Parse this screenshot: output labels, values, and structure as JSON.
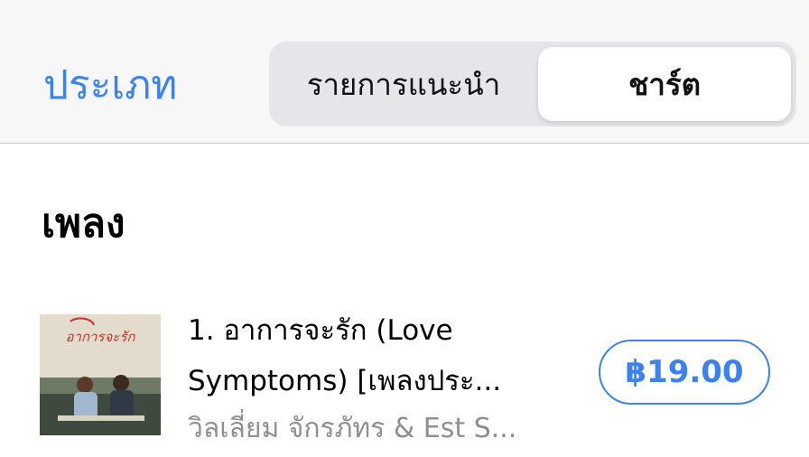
{
  "topbar": {
    "category_link": "ประเภท",
    "segments": {
      "featured": "รายการแนะนำ",
      "charts": "ชาร์ต"
    },
    "selected_segment": "ชาร์ต"
  },
  "section": {
    "title": "เพลง"
  },
  "songs": [
    {
      "title_line1": "1. อาการจะรัก (Love",
      "title_line2": "Symptoms) [เพลงประ...",
      "artist": "วิลเลี่ยม จักรภัทร & Est S...",
      "price": "฿19.00",
      "artwork_icon": "album-artwork-icon",
      "artwork_text": "อาการจะรัก"
    }
  ],
  "colors": {
    "accent": "#3b82f0",
    "secondary_text": "#8e8e93",
    "topbar_bg": "#f7f7f7",
    "segmented_bg": "#e5e5ea"
  }
}
